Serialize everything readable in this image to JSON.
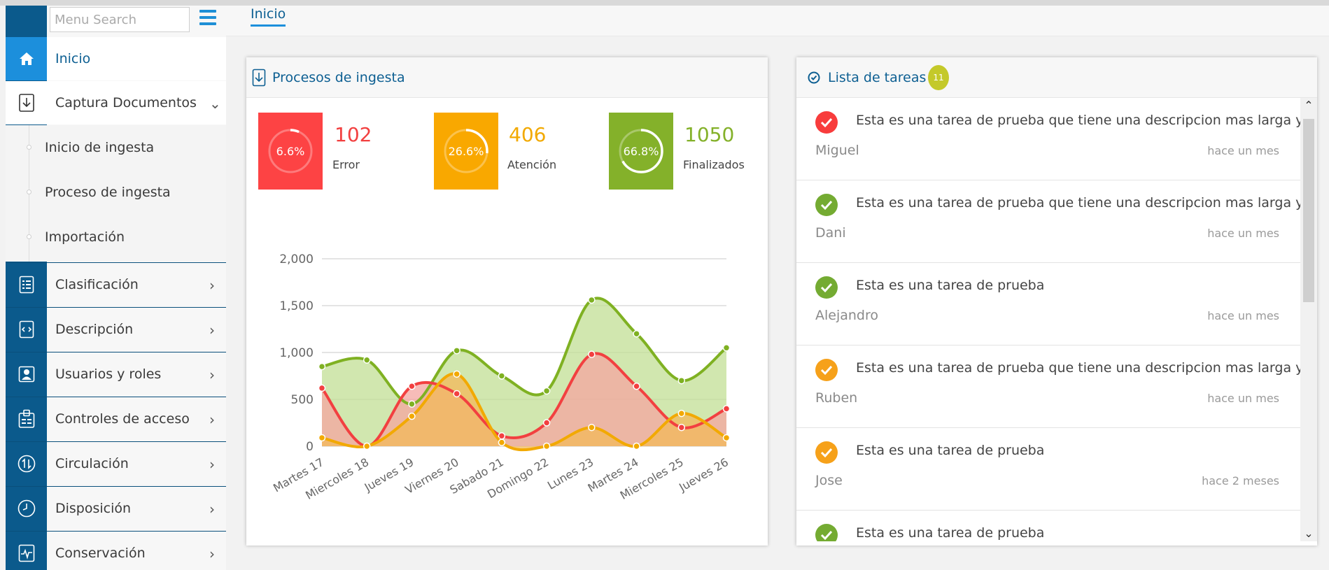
{
  "sidebar": {
    "search_placeholder": "Menu Search",
    "items": [
      {
        "label": "Inicio",
        "icon": "home-icon"
      },
      {
        "label": "Captura Documentos",
        "icon": "download-doc-icon"
      },
      {
        "label": "Clasificación",
        "icon": "list-icon"
      },
      {
        "label": "Descripción",
        "icon": "code-doc-icon"
      },
      {
        "label": "Usuarios y roles",
        "icon": "user-card-icon"
      },
      {
        "label": "Controles de acceso",
        "icon": "badge-icon"
      },
      {
        "label": "Circulación",
        "icon": "transfer-icon"
      },
      {
        "label": "Disposición",
        "icon": "clock-icon"
      },
      {
        "label": "Conservación",
        "icon": "pulse-icon"
      }
    ],
    "subitems": [
      {
        "label": "Inicio de ingesta"
      },
      {
        "label": "Proceso de ingesta"
      },
      {
        "label": "Importación"
      }
    ]
  },
  "breadcrumb": "Inicio",
  "ingesta": {
    "title": "Procesos de ingesta",
    "stats": [
      {
        "pct": "6.6%",
        "pct_value": 6.6,
        "value": "102",
        "label": "Error",
        "color": "#fd4344"
      },
      {
        "pct": "26.6%",
        "pct_value": 26.6,
        "value": "406",
        "label": "Atención",
        "color": "#f9a800"
      },
      {
        "pct": "66.8%",
        "pct_value": 66.8,
        "value": "1050",
        "label": "Finalizados",
        "color": "#84b12a"
      }
    ]
  },
  "chart_data": {
    "type": "area",
    "categories": [
      "Martes 17",
      "Miercoles 18",
      "Jueves 19",
      "Viernes 20",
      "Sabado 21",
      "Domingo 22",
      "Lunes 23",
      "Martes 24",
      "Miercoles 25",
      "Jueves 26"
    ],
    "yticks": [
      "0",
      "500",
      "1,000",
      "1,500",
      "2,000"
    ],
    "ylim": [
      0,
      2000
    ],
    "series": [
      {
        "color": "#7fb122",
        "fill": "#c2df94",
        "values": [
          850,
          920,
          450,
          1020,
          750,
          590,
          1560,
          1200,
          700,
          1050
        ]
      },
      {
        "color": "#f24040",
        "fill": "#f4a6a0",
        "values": [
          620,
          0,
          640,
          560,
          110,
          250,
          980,
          640,
          200,
          400
        ]
      },
      {
        "color": "#f2a900",
        "fill": "#f3b85a",
        "values": [
          90,
          0,
          320,
          770,
          40,
          0,
          200,
          0,
          350,
          90
        ]
      }
    ]
  },
  "tasks": {
    "title": "Lista de tareas",
    "count": "11",
    "items": [
      {
        "title": "Esta es una tarea de prueba que tiene una descripcion mas larga y ...",
        "user": "Miguel",
        "time": "hace un mes",
        "color": "#f83c3c"
      },
      {
        "title": "Esta es una tarea de prueba que tiene una descripcion mas larga y ...",
        "user": "Dani",
        "time": "hace un mes",
        "color": "#74ab32"
      },
      {
        "title": "Esta es una tarea de prueba",
        "user": "Alejandro",
        "time": "hace un mes",
        "color": "#74ab32"
      },
      {
        "title": "Esta es una tarea de prueba que tiene una descripcion mas larga y ...",
        "user": "Ruben",
        "time": "hace un mes",
        "color": "#f6a11a"
      },
      {
        "title": "Esta es una tarea de prueba",
        "user": "Jose",
        "time": "hace 2 meses",
        "color": "#f6a11a"
      },
      {
        "title": "Esta es una tarea de prueba",
        "user": "",
        "time": "",
        "color": "#74ab32"
      }
    ]
  }
}
